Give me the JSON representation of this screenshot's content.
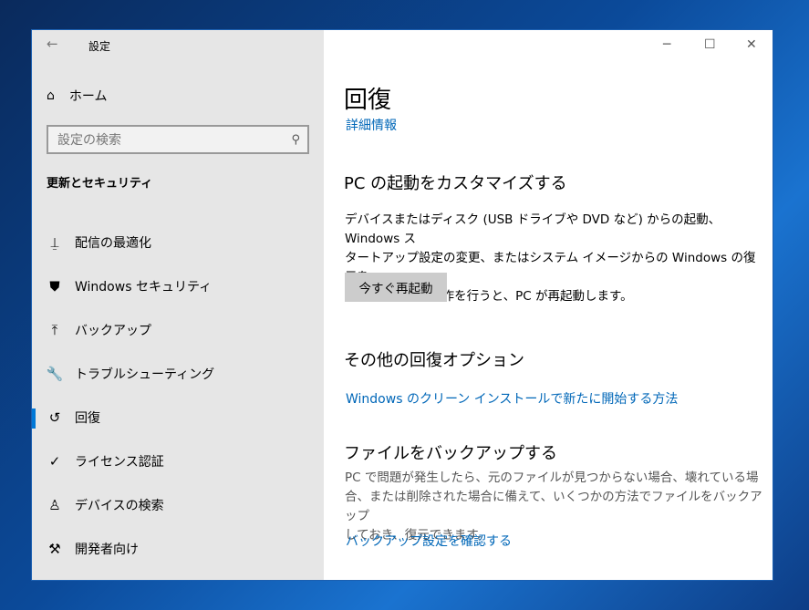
{
  "window": {
    "title": "設定",
    "controls": {
      "minimize": "─",
      "maximize": "☐",
      "close": "✕"
    }
  },
  "sidebar": {
    "back": "←",
    "home": "ホーム",
    "search_placeholder": "設定の検索",
    "section": "更新とセキュリティ",
    "items": [
      {
        "label": "配信の最適化",
        "icon": "delivery-optimization-icon",
        "glyph": "⍊"
      },
      {
        "label": "Windows セキュリティ",
        "icon": "shield-icon",
        "glyph": "⛊"
      },
      {
        "label": "バックアップ",
        "icon": "backup-arrow-icon",
        "glyph": "⤒"
      },
      {
        "label": "トラブルシューティング",
        "icon": "wrench-icon",
        "glyph": "🔧"
      },
      {
        "label": "回復",
        "icon": "history-icon",
        "glyph": "↺"
      },
      {
        "label": "ライセンス認証",
        "icon": "check-circle-icon",
        "glyph": "✓"
      },
      {
        "label": "デバイスの検索",
        "icon": "find-device-icon",
        "glyph": "♙"
      },
      {
        "label": "開発者向け",
        "icon": "developer-tools-icon",
        "glyph": "⚒"
      }
    ],
    "selected": "回復"
  },
  "main": {
    "title": "回復",
    "details_link": "詳細情報",
    "startup": {
      "heading": "PC の起動をカスタマイズする",
      "lines": [
        "デバイスまたはディスク (USB ドライブや DVD など) からの起動、Windows ス",
        "タートアップ設定の変更、またはシステム イメージからの Windows の復元を",
        "行います。この操作を行うと、PC が再起動します。"
      ],
      "button": "今すぐ再起動"
    },
    "other": {
      "heading": "その他の回復オプション",
      "link": "Windows のクリーン インストールで新たに開始する方法"
    },
    "backup": {
      "heading": "ファイルをバックアップする",
      "lines": [
        "PC で問題が発生したら、元のファイルが見つからない場合、壊れている場",
        "合、または削除された場合に備えて、いくつかの方法でファイルをバックアップ",
        "しておき、復元できます。"
      ],
      "link": "バックアップ設定を確認する"
    }
  }
}
